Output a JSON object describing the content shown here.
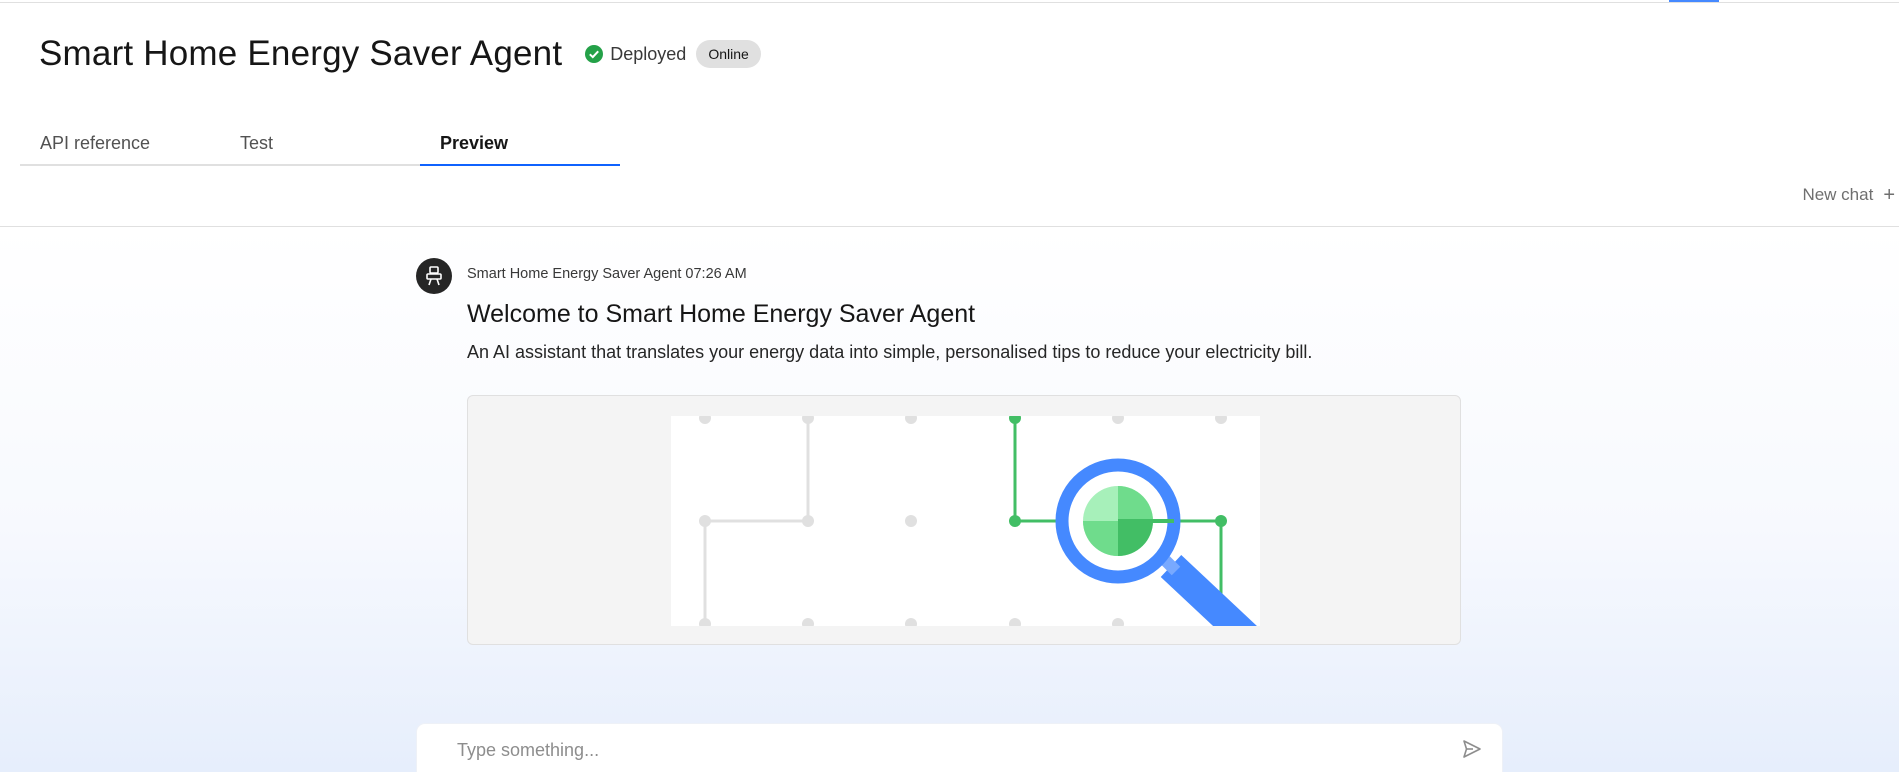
{
  "header": {
    "title": "Smart Home Energy Saver Agent",
    "status_label": "Deployed",
    "badge": "Online",
    "colors": {
      "deployed": "#24a148",
      "badge_bg": "#e0e0e0"
    }
  },
  "tabs": [
    {
      "label": "API reference",
      "active": false
    },
    {
      "label": "Test",
      "active": false
    },
    {
      "label": "Preview",
      "active": true
    }
  ],
  "toolbar": {
    "new_chat_label": "New chat",
    "new_chat_icon": "plus-icon"
  },
  "message": {
    "sender": "Smart Home Energy Saver Agent",
    "time": "07:26 AM",
    "avatar_icon": "robot-icon",
    "title": "Welcome to Smart Home Energy Saver Agent",
    "description": "An AI assistant that translates your energy data into simple, personalised tips to reduce your electricity bill.",
    "image": "magnifier-network-illustration"
  },
  "composer": {
    "placeholder": "Type something...",
    "send_icon": "send-icon"
  },
  "colors": {
    "accent": "#0f62fe",
    "magnifier": "#4589ff",
    "network_green": "#42be65"
  }
}
